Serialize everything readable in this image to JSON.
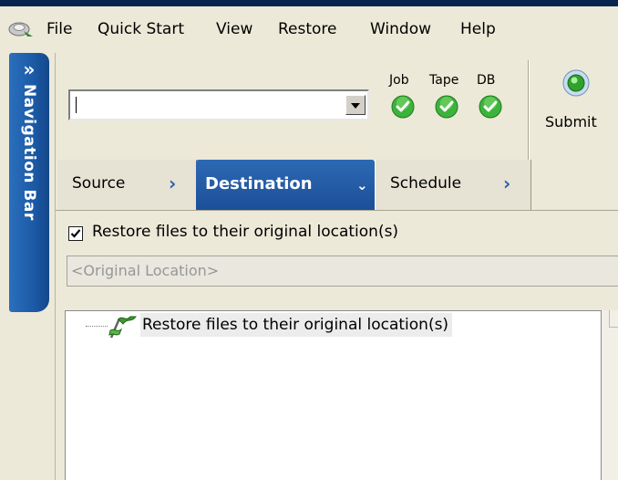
{
  "menu": {
    "items": [
      "File",
      "Quick Start",
      "View",
      "Restore",
      "Window",
      "Help"
    ]
  },
  "navigation": {
    "label": "Navigation Bar",
    "toggle_glyph": "»"
  },
  "toolbar": {
    "combo_value": "",
    "status": {
      "labels": [
        "Job",
        "Tape",
        "DB"
      ],
      "state": "ok"
    },
    "submit_label": "Submit"
  },
  "tabs": [
    {
      "label": "Source",
      "arrow": "›",
      "active": false
    },
    {
      "label": "Destination",
      "arrow": "⌄",
      "active": true
    },
    {
      "label": "Schedule",
      "arrow": "›",
      "active": false
    }
  ],
  "destination": {
    "restore_original_checked": true,
    "restore_original_label": "Restore files to their original location(s)",
    "location_placeholder": "<Original Location>",
    "tree": [
      {
        "label": "Restore files to their original location(s)",
        "icon": "green-flag-icon"
      }
    ]
  },
  "colors": {
    "accent": "#1c5aa6",
    "window_bg": "#ece9d8",
    "status_ok": "#3cb33c",
    "title_bar": "#08244e"
  },
  "icons": {
    "app": "backup-app-icon",
    "combo_dropdown": "dropdown-arrow-icon",
    "status": "green-check-circle-icon",
    "submit": "green-orb-submit-icon",
    "tab_arrow": "chevron-right-icon",
    "active_tab_arrow": "chevron-down-icon"
  }
}
